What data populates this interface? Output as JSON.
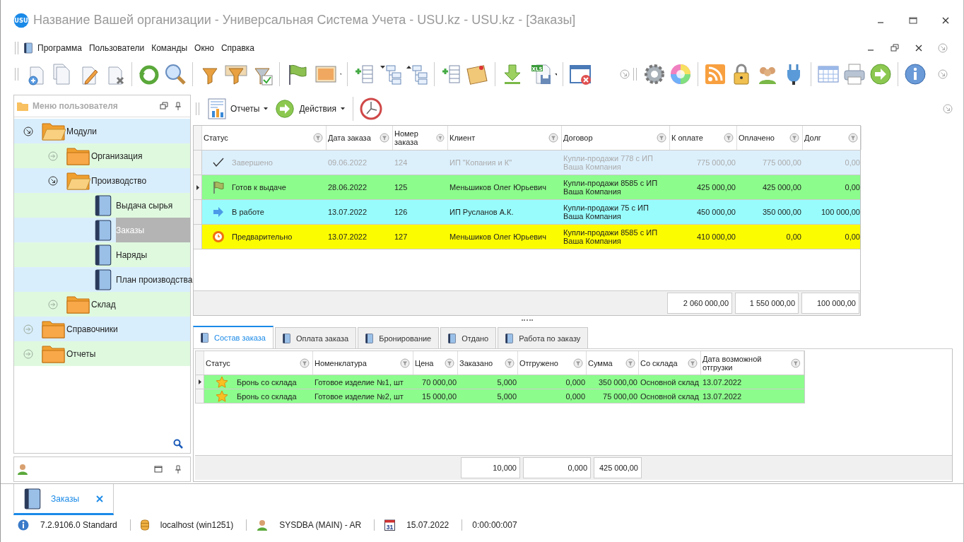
{
  "window": {
    "title": "Название Вашей организации - Универсальная Система Учета - USU.kz - USU.kz - [Заказы]",
    "logo_text": "USU"
  },
  "menu": [
    "Программа",
    "Пользователи",
    "Команды",
    "Окно",
    "Справка"
  ],
  "toolbar": {
    "export_badge": "XLS"
  },
  "sidebar": {
    "title": "Меню пользователя",
    "tree": [
      {
        "label": "Модули",
        "kind": "folder",
        "expanded": true,
        "selected": false,
        "children": [
          {
            "label": "Организация",
            "kind": "folder",
            "expanded": false,
            "selected": false
          },
          {
            "label": "Производство",
            "kind": "folder",
            "expanded": true,
            "selected": false,
            "children": [
              {
                "label": "Выдача сырья",
                "kind": "book",
                "selected": false
              },
              {
                "label": "Заказы",
                "kind": "book",
                "selected": true
              },
              {
                "label": "Наряды",
                "kind": "book",
                "selected": false
              },
              {
                "label": "План производства",
                "kind": "book",
                "selected": false
              }
            ]
          },
          {
            "label": "Склад",
            "kind": "folder",
            "expanded": false,
            "selected": false
          }
        ]
      },
      {
        "label": "Справочники",
        "kind": "folder",
        "expanded": false,
        "selected": false
      },
      {
        "label": "Отчеты",
        "kind": "folder",
        "expanded": false,
        "selected": false
      }
    ]
  },
  "actions": [
    {
      "label": "Отчеты",
      "kind": "reports"
    },
    {
      "label": "Действия",
      "kind": "actions"
    }
  ],
  "orders": {
    "columns": [
      "Статус",
      "Дата заказа",
      "Номер заказа",
      "Клиент",
      "Договор",
      "К оплате",
      "Оплачено",
      "Долг"
    ],
    "rows": [
      {
        "kind": "check",
        "color": "#dcf0fc",
        "dimmed": true,
        "current": false,
        "cells": [
          "Завершено",
          "09.06.2022",
          "124",
          "ИП \"Копания и К\"",
          "Купли-продажи 778 с ИП Ваша Компания",
          "775 000,00",
          "775 000,00",
          "0,00"
        ]
      },
      {
        "kind": "flag",
        "color": "#8cfc8c",
        "dimmed": false,
        "current": true,
        "cells": [
          "Готов к выдаче",
          "28.06.2022",
          "125",
          "Меньшиков Олег Юрьевич",
          "Купли-продажи 8585 с ИП Ваша Компания",
          "425 000,00",
          "425 000,00",
          "0,00"
        ]
      },
      {
        "kind": "arrow",
        "color": "#98fcfc",
        "dimmed": false,
        "current": false,
        "cells": [
          "В работе",
          "13.07.2022",
          "126",
          "ИП Русланов А.К.",
          "Купли-продажи 75 с ИП Ваша Компания",
          "450 000,00",
          "350 000,00",
          "100 000,00"
        ]
      },
      {
        "kind": "clock",
        "color": "#fcfc00",
        "dimmed": false,
        "current": false,
        "cells": [
          "Предварительно",
          "13.07.2022",
          "127",
          "Меньшиков Олег Юрьевич",
          "Купли-продажи 8585 с ИП Ваша Компания",
          "410 000,00",
          "0,00",
          "0,00"
        ]
      }
    ],
    "totals": [
      "2 060 000,00",
      "1 550 000,00",
      "100 000,00"
    ]
  },
  "detail_tabs": [
    {
      "label": "Состав заказа",
      "selected": true
    },
    {
      "label": "Оплата заказа",
      "selected": false
    },
    {
      "label": "Бронирование",
      "selected": false
    },
    {
      "label": "Отдано",
      "selected": false
    },
    {
      "label": "Работа по заказу",
      "selected": false
    }
  ],
  "items": {
    "columns": [
      "Статус",
      "Номенклатура",
      "Цена",
      "Заказано",
      "Отгружено",
      "Сумма",
      "Со склада",
      "Дата возможной отгрузки"
    ],
    "rows": [
      {
        "current": true,
        "cells": [
          "Бронь со склада",
          "Готовое изделие №1, шт",
          "70 000,00",
          "5,000",
          "0,000",
          "350 000,00",
          "Основной склад",
          "13.07.2022"
        ]
      },
      {
        "current": false,
        "cells": [
          "Бронь со склада",
          "Готовое изделие №2, шт",
          "15 000,00",
          "5,000",
          "0,000",
          "75 000,00",
          "Основной склад",
          "13.07.2022"
        ]
      }
    ],
    "totals": [
      "10,000",
      "0,000",
      "425 000,00"
    ]
  },
  "document_tabs": [
    {
      "label": "Заказы",
      "selected": true
    }
  ],
  "status_bar": [
    {
      "kind": "info",
      "text": "7.2.9106.0 Standard"
    },
    {
      "kind": "database",
      "text": "localhost (win1251)"
    },
    {
      "kind": "user",
      "text": "SYSDBA (MAIN) - AR"
    },
    {
      "kind": "calendar",
      "text": "15.07.2022",
      "icon_text": "31"
    },
    {
      "kind": "timer",
      "text": "0:00:00:007"
    }
  ]
}
